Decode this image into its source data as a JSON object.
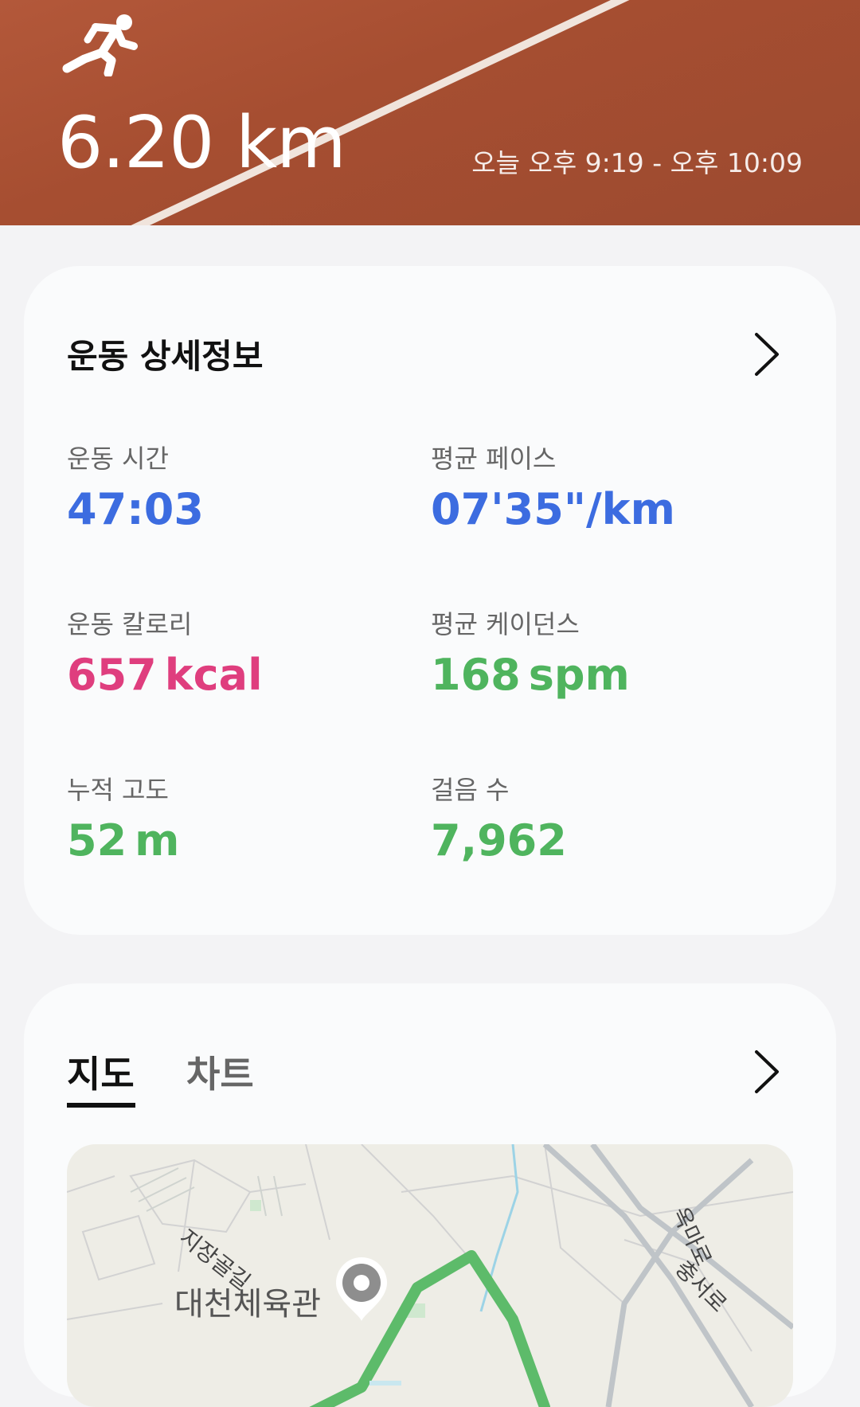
{
  "header": {
    "activity_icon": "running-person-icon",
    "distance": "6.20 km",
    "time_range": "오늘 오후 9:19 - 오후 10:09"
  },
  "details": {
    "title": "운동 상세정보",
    "chevron_icon": "chevron-right-icon",
    "metrics": [
      {
        "label": "운동 시간",
        "value": "47:03",
        "unit": ""
      },
      {
        "label": "평균 페이스",
        "value": "07'35\"/km",
        "unit": ""
      },
      {
        "label": "운동 칼로리",
        "value": "657",
        "unit": "kcal"
      },
      {
        "label": "평균 케이던스",
        "value": "168",
        "unit": "spm"
      },
      {
        "label": "누적 고도",
        "value": "52",
        "unit": "m"
      },
      {
        "label": "걸음 수",
        "value": "7,962",
        "unit": ""
      }
    ]
  },
  "map_section": {
    "tabs": [
      {
        "label": "지도",
        "active": true
      },
      {
        "label": "차트",
        "active": false
      }
    ],
    "chevron_icon": "chevron-right-icon",
    "map": {
      "venue_label": "대천체육관",
      "road_labels": [
        "지장골길",
        "옥마로",
        "충서로"
      ],
      "pin_icon": "location-pin-icon"
    }
  },
  "colors": {
    "hero_bg": "#a64e31",
    "blue": "#3c6ce0",
    "pink": "#df3e7e",
    "green": "#4fb45e"
  }
}
